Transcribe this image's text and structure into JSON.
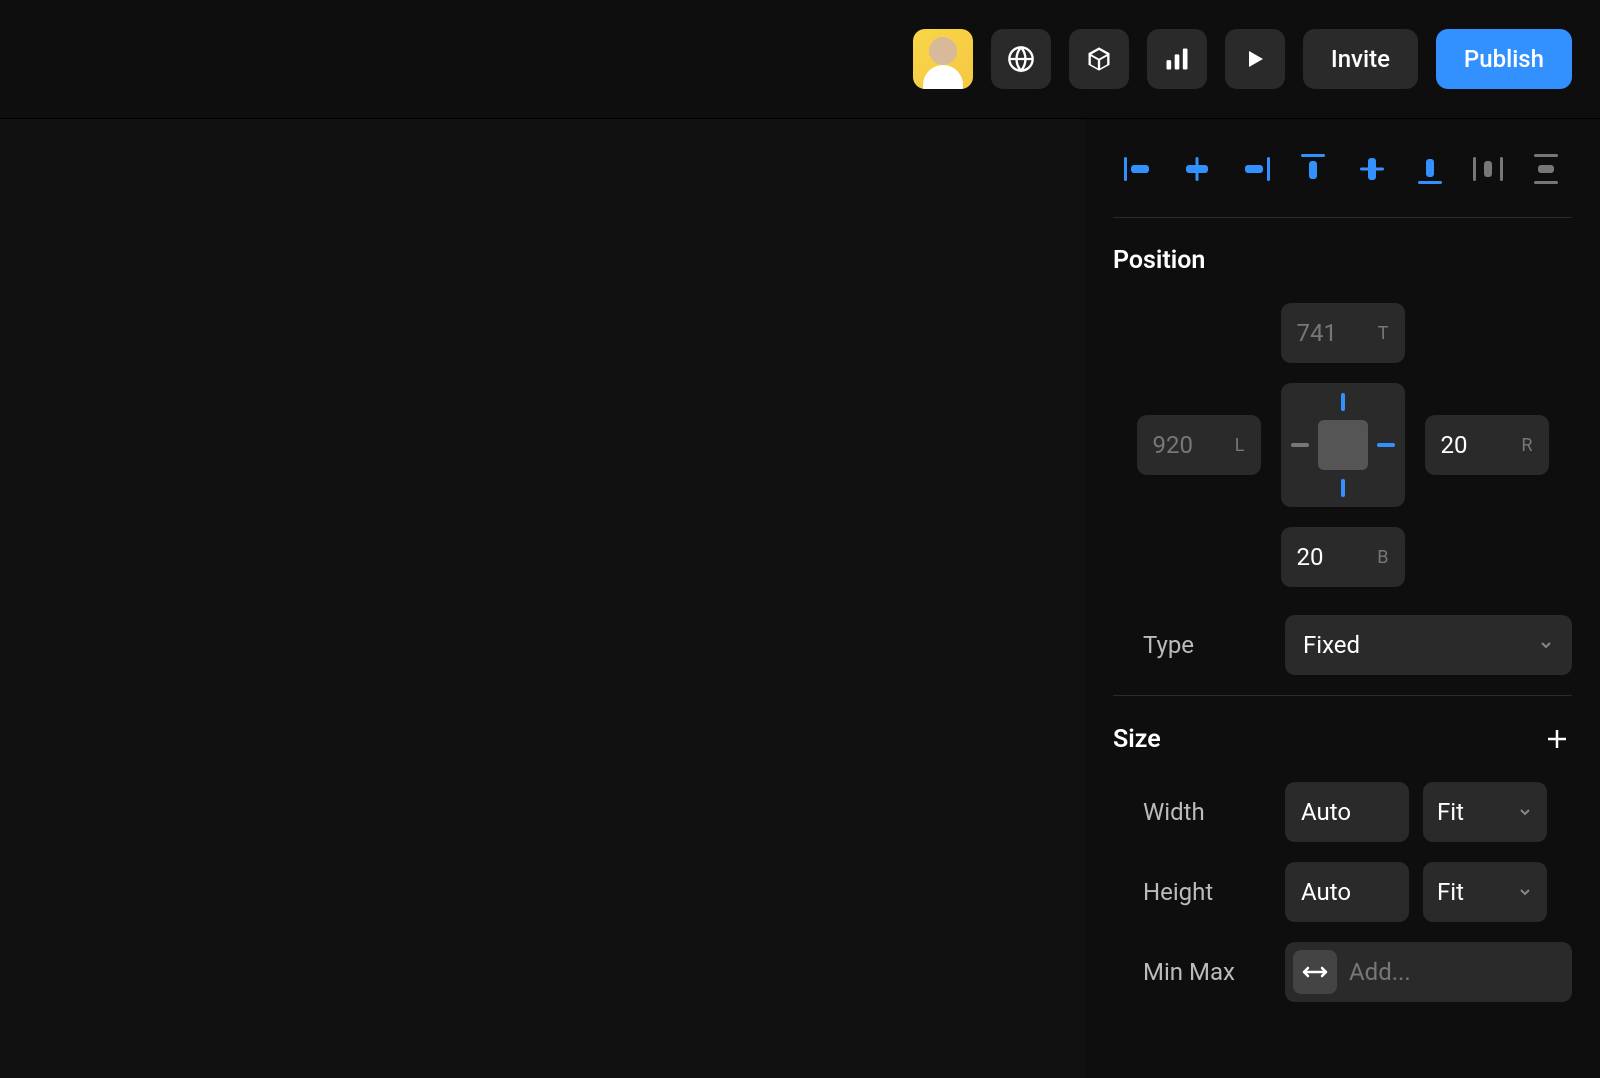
{
  "toolbar": {
    "invite_label": "Invite",
    "publish_label": "Publish"
  },
  "position": {
    "title": "Position",
    "top": "741",
    "top_label": "T",
    "left": "920",
    "left_label": "L",
    "right": "20",
    "right_label": "R",
    "bottom": "20",
    "bottom_label": "B",
    "type_label": "Type",
    "type_value": "Fixed"
  },
  "size": {
    "title": "Size",
    "width_label": "Width",
    "width_value": "Auto",
    "width_mode": "Fit",
    "height_label": "Height",
    "height_value": "Auto",
    "height_mode": "Fit",
    "minmax_label": "Min Max",
    "minmax_placeholder": "Add..."
  }
}
